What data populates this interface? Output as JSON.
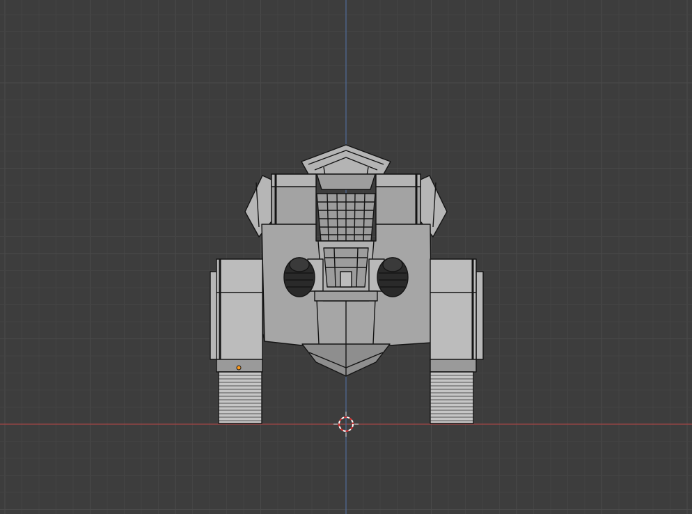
{
  "viewport": {
    "background": "#3d3d3d",
    "grid_minor_color": "#444444",
    "grid_major_color": "#4a4a4a",
    "x_axis_color": "#a34545",
    "z_axis_color": "#4f6c9a"
  },
  "scene": {
    "object": "tracked-vehicle-model",
    "view": "front-orthographic",
    "mesh_fill": "#a8a8a8",
    "mesh_fill_light": "#bdbdbd",
    "mesh_fill_dark": "#8a8a8a",
    "wire_color": "#141414",
    "origin_color": "#ff9a1a",
    "cursor_colors": [
      "#e03434",
      "#ffffff"
    ]
  }
}
